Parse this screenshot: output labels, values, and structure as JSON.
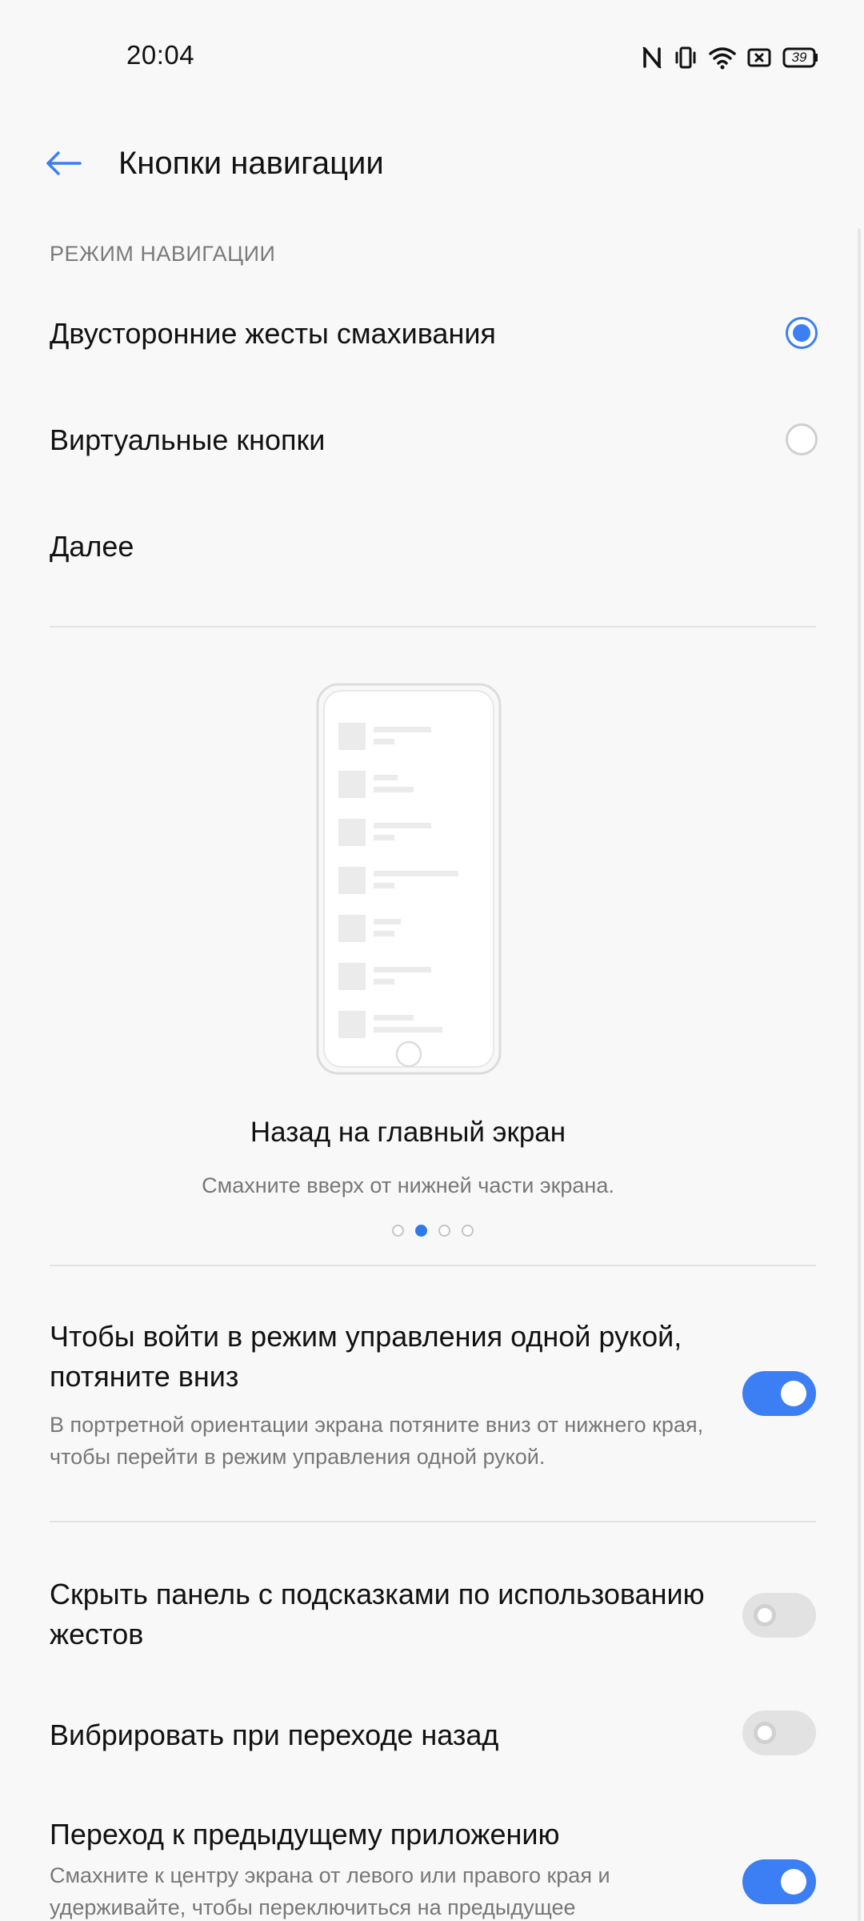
{
  "status_bar": {
    "time": "20:04",
    "battery": "39",
    "icons": [
      "nfc-icon",
      "vibrate-icon",
      "wifi-icon",
      "screen-cast-icon",
      "battery-icon"
    ]
  },
  "header": {
    "back_icon": "arrow-left-icon",
    "title": "Кнопки навигации"
  },
  "nav_mode": {
    "section_label": "РЕЖИМ НАВИГАЦИИ",
    "options": [
      {
        "label": "Двусторонние жесты смахивания",
        "selected": true
      },
      {
        "label": "Виртуальные кнопки",
        "selected": false
      }
    ],
    "more_label": "Далее"
  },
  "tutorial": {
    "title": "Назад на главный экран",
    "subtitle": "Смахните вверх от нижней части экрана.",
    "page_count": 4,
    "current_page": 2
  },
  "settings": {
    "one_hand": {
      "title": "Чтобы войти в режим управления одной рукой, потяните вниз",
      "description": "В портретной ориентации экрана потяните вниз от нижнего края, чтобы перейти в режим управления одной рукой.",
      "enabled": true
    },
    "hide_hint_bar": {
      "title": "Скрыть панель с подсказками по использованию жестов",
      "enabled": false
    },
    "vibrate_back": {
      "title": "Вибрировать при переходе назад",
      "enabled": false
    },
    "prev_app": {
      "title": "Переход к предыдущему приложению",
      "description": "Смахните к центру экрана от левого или правого края и удерживайте, чтобы переключиться на предыдущее",
      "enabled": true
    }
  },
  "colors": {
    "accent": "#3c7ef3",
    "background": "#f8f8f8"
  }
}
